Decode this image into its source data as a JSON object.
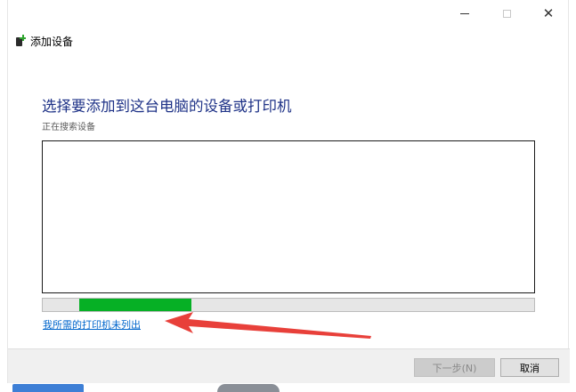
{
  "window": {
    "title": "添加设备",
    "controls": {
      "close_glyph": "✕"
    }
  },
  "main": {
    "heading": "选择要添加到这台电脑的设备或打印机",
    "status": "正在搜索设备",
    "progress": 0.3,
    "progress_offset": 0.074,
    "missing_printer_link": "我所需的打印机未列出"
  },
  "footer": {
    "next_label": "下一步(N)",
    "cancel_label": "取消"
  },
  "colors": {
    "heading": "#1e3287",
    "progress": "#06b025",
    "link": "#0066cc",
    "arrow": "#e8403a"
  },
  "icons": {
    "title": "add-device-icon",
    "minimize": "minimize-icon",
    "maximize": "maximize-icon",
    "close": "close-icon"
  }
}
